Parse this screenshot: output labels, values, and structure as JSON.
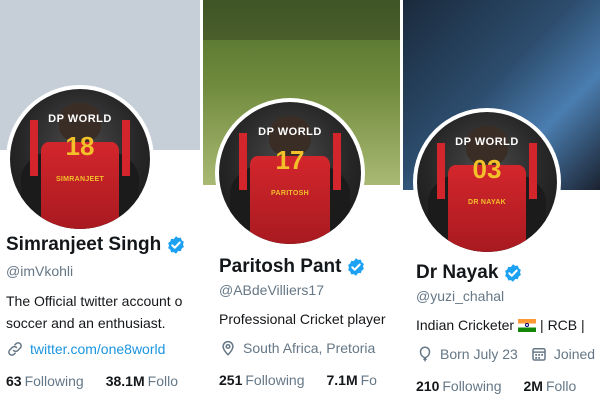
{
  "colors": {
    "verified": "#1da1f2",
    "link": "#1b95e0",
    "muted": "#657786",
    "text": "#14171a",
    "jersey_red": "#d3262c",
    "jersey_gold": "#f4c02a"
  },
  "profiles": [
    {
      "name": "Simranjeet Singh",
      "handle": "@imVkohli",
      "bio_lines": [
        "The Official twitter account o",
        "soccer and an enthusiast."
      ],
      "link_icon": "link-icon",
      "link_text": "twitter.com/one8world",
      "following_count": "63",
      "following_label": "Following",
      "followers_count": "38.1M",
      "followers_label": "Follo",
      "jersey": {
        "sponsor": "DP WORLD",
        "number": "18",
        "name": "SIMRANJEET"
      }
    },
    {
      "name": "Paritosh Pant",
      "handle": "@ABdeVilliers17",
      "bio_lines": [
        "Professional Cricket player"
      ],
      "location_icon": "location-pin-icon",
      "location_text": "South Africa, Pretoria",
      "following_count": "251",
      "following_label": "Following",
      "followers_count": "7.1M",
      "followers_label": "Fo",
      "jersey": {
        "sponsor": "DP WORLD",
        "number": "17",
        "name": "PARITOSH"
      }
    },
    {
      "name": "Dr Nayak",
      "handle": "@yuzi_chahal",
      "bio_prefix": "Indian Cricketer",
      "bio_suffix": "| RCB |",
      "flag_icon": "india-flag-icon",
      "born_icon": "balloon-icon",
      "born_text": "Born July 23",
      "joined_icon": "calendar-icon",
      "joined_text": "Joined",
      "following_count": "210",
      "following_label": "Following",
      "followers_count": "2M",
      "followers_label": "Follo",
      "jersey": {
        "sponsor": "DP WORLD",
        "number": "03",
        "name": "DR NAYAK"
      }
    }
  ]
}
